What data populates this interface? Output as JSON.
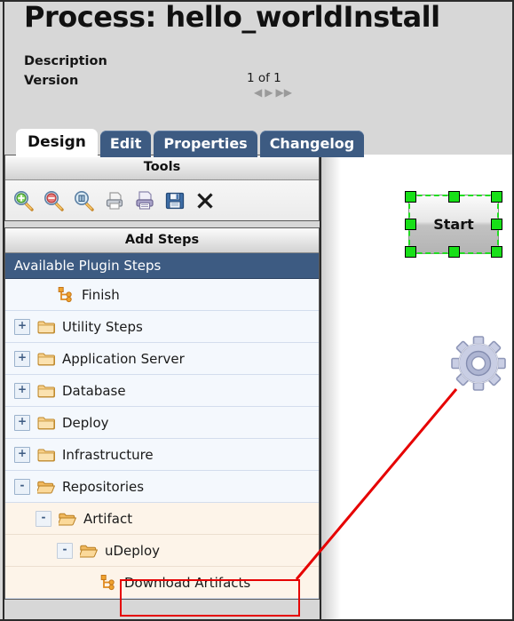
{
  "header": {
    "title": "Process: hello_worldInstall",
    "description_label": "Description",
    "version_label": "Version",
    "version_count": "1 of 1",
    "nav_prev": "◀",
    "nav_next": "▶",
    "nav_last": "▶▶"
  },
  "tabs": [
    {
      "label": "Design",
      "active": true
    },
    {
      "label": "Edit",
      "active": false
    },
    {
      "label": "Properties",
      "active": false
    },
    {
      "label": "Changelog",
      "active": false
    }
  ],
  "tools_panel": {
    "title": "Tools",
    "buttons": [
      {
        "name": "zoom-in-icon",
        "tooltip": "Zoom In"
      },
      {
        "name": "zoom-out-icon",
        "tooltip": "Zoom Out"
      },
      {
        "name": "zoom-fit-icon",
        "tooltip": "Zoom To Fit"
      },
      {
        "name": "print-icon",
        "tooltip": "Print"
      },
      {
        "name": "print-preview-icon",
        "tooltip": "Print Preview"
      },
      {
        "name": "save-icon",
        "tooltip": "Save"
      },
      {
        "name": "delete-icon",
        "tooltip": "Delete"
      }
    ]
  },
  "add_steps_panel": {
    "title": "Add Steps",
    "tree_header": "Available Plugin Steps",
    "rows": [
      {
        "label": "Finish",
        "indent": 1,
        "toggle": "",
        "icon": "step",
        "tint": "cool",
        "highlighted": false
      },
      {
        "label": "Utility Steps",
        "indent": 0,
        "toggle": "+",
        "icon": "folder-closed",
        "tint": "cool",
        "highlighted": false
      },
      {
        "label": "Application Server",
        "indent": 0,
        "toggle": "+",
        "icon": "folder-closed",
        "tint": "cool",
        "highlighted": false
      },
      {
        "label": "Database",
        "indent": 0,
        "toggle": "+",
        "icon": "folder-closed",
        "tint": "cool",
        "highlighted": false
      },
      {
        "label": "Deploy",
        "indent": 0,
        "toggle": "+",
        "icon": "folder-closed",
        "tint": "cool",
        "highlighted": false
      },
      {
        "label": "Infrastructure",
        "indent": 0,
        "toggle": "+",
        "icon": "folder-closed",
        "tint": "cool",
        "highlighted": false
      },
      {
        "label": "Repositories",
        "indent": 0,
        "toggle": "-",
        "icon": "folder-open",
        "tint": "cool",
        "highlighted": false
      },
      {
        "label": "Artifact",
        "indent": 1,
        "toggle": "-",
        "icon": "folder-open",
        "tint": "warm",
        "highlighted": false
      },
      {
        "label": "uDeploy",
        "indent": 2,
        "toggle": "-",
        "icon": "folder-open",
        "tint": "warm",
        "highlighted": false
      },
      {
        "label": "Download Artifacts",
        "indent": 3,
        "toggle": "",
        "icon": "step",
        "tint": "warm",
        "highlighted": true
      }
    ]
  },
  "canvas": {
    "start_node_label": "Start",
    "gear_icon_name": "gear-icon"
  },
  "annotation": {
    "highlight_color": "#e60000",
    "pointer_from": "Download Artifacts",
    "pointer_to": "gear-icon"
  },
  "colors": {
    "tab_blue": "#3d5b82",
    "tree_header_blue": "#3d5b82",
    "row_cool": "#f4f8fd",
    "row_warm": "#fdf4e9",
    "selection_green": "#18e018",
    "annotation_red": "#e60000",
    "page_bg": "#d7d7d7"
  }
}
